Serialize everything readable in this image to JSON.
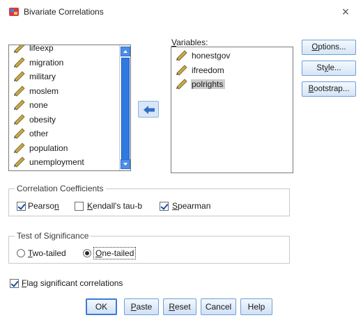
{
  "window": {
    "title": "Bivariate Correlations",
    "close_glyph": "×"
  },
  "source_list": {
    "items": [
      {
        "label": "lifeexp"
      },
      {
        "label": "migration"
      },
      {
        "label": "military"
      },
      {
        "label": "moslem"
      },
      {
        "label": "none"
      },
      {
        "label": "obesity"
      },
      {
        "label": "other"
      },
      {
        "label": "population"
      },
      {
        "label": "unemployment"
      }
    ]
  },
  "variables": {
    "label": "Variables:",
    "items": [
      {
        "label": "honestgov",
        "selected": false
      },
      {
        "label": "ifreedom",
        "selected": false
      },
      {
        "label": "polrights",
        "selected": true
      }
    ]
  },
  "side_buttons": {
    "options": "Options...",
    "style": "Style...",
    "bootstrap": "Bootstrap..."
  },
  "correlation": {
    "title": "Correlation Coefficients",
    "pearson": {
      "label": "Pearson",
      "checked": true
    },
    "kendall": {
      "label": "Kendall's tau-b",
      "checked": false
    },
    "spearman": {
      "label": "Spearman",
      "checked": true
    }
  },
  "significance": {
    "title": "Test of Significance",
    "two_tailed": {
      "label": "Two-tailed",
      "checked": false
    },
    "one_tailed": {
      "label": "One-tailed",
      "checked": true
    }
  },
  "flag": {
    "label": "Flag significant correlations",
    "checked": true
  },
  "buttons": {
    "ok": "OK",
    "paste": "Paste",
    "reset": "Reset",
    "cancel": "Cancel",
    "help": "Help"
  },
  "colors": {
    "accent": "#2f7ae0",
    "button_border": "#6f9ed6",
    "selected_bg": "#cdcdcd"
  }
}
